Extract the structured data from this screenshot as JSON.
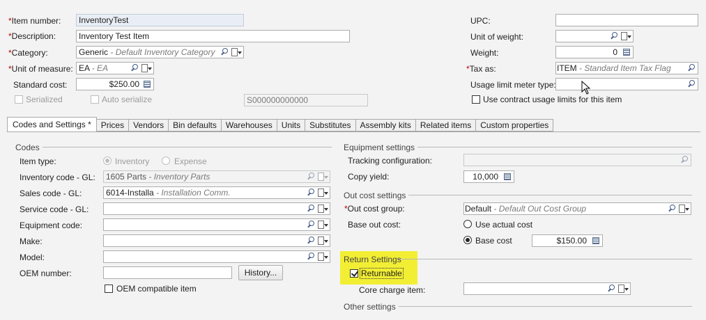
{
  "header": {
    "item_number": {
      "label": "Item number:",
      "value": "InventoryTest"
    },
    "description": {
      "label": "Description:",
      "value": "Inventory Test Item"
    },
    "category": {
      "label": "Category:",
      "code": "Generic",
      "desc": "- Default Inventory Category"
    },
    "unit_of_measure": {
      "label": "Unit of measure:",
      "code": "EA",
      "desc": "- EA"
    },
    "standard_cost": {
      "label": "Standard cost:",
      "value": "$250.00"
    },
    "serialized": {
      "label": "Serialized"
    },
    "auto_serialize": {
      "label": "Auto serialize"
    },
    "serial_template": "S000000000000",
    "upc": {
      "label": "UPC:",
      "value": ""
    },
    "unit_of_weight": {
      "label": "Unit of weight:",
      "value": ""
    },
    "weight": {
      "label": "Weight:",
      "value": "0"
    },
    "tax_as": {
      "label": "Tax as:",
      "code": "ITEM",
      "desc": "- Standard Item Tax Flag"
    },
    "usage_limit": {
      "label": "Usage limit meter type:",
      "value": ""
    },
    "contract_usage": {
      "label": "Use contract usage limits for this item"
    }
  },
  "tabs": [
    "Codes and Settings *",
    "Prices",
    "Vendors",
    "Bin defaults",
    "Warehouses",
    "Units",
    "Substitutes",
    "Assembly kits",
    "Related items",
    "Custom properties"
  ],
  "codes": {
    "section": "Codes",
    "item_type": {
      "label": "Item type:",
      "opt1": "Inventory",
      "opt2": "Expense"
    },
    "inventory_gl": {
      "label": "Inventory code - GL:",
      "code": "1605 Parts",
      "desc": "- Inventory Parts"
    },
    "sales_gl": {
      "label": "Sales code - GL:",
      "code": "6014-Installa",
      "desc": "- Installation Comm."
    },
    "service_gl": {
      "label": "Service code - GL:",
      "value": ""
    },
    "equipment": {
      "label": "Equipment code:",
      "value": ""
    },
    "make": {
      "label": "Make:",
      "value": ""
    },
    "model": {
      "label": "Model:",
      "value": ""
    },
    "oem": {
      "label": "OEM number:",
      "value": ""
    },
    "history_button": "History...",
    "oem_compatible": "OEM compatible item"
  },
  "equipment": {
    "section": "Equipment settings",
    "tracking": {
      "label": "Tracking configuration:",
      "value": ""
    },
    "copy_yield": {
      "label": "Copy yield:",
      "value": "10,000"
    }
  },
  "out_cost": {
    "section": "Out cost settings",
    "group": {
      "label": "Out cost group:",
      "code": "Default",
      "desc": "- Default Out Cost Group"
    },
    "base_label": "Base out cost:",
    "use_actual": "Use actual cost",
    "base_cost": "Base cost",
    "base_cost_value": "$150.00"
  },
  "return": {
    "section": "Return Settings",
    "returnable": "Returnable",
    "core_charge": {
      "label": "Core charge item:",
      "value": ""
    }
  },
  "other": {
    "section": "Other settings"
  },
  "colors": {
    "highlight": "#f2ee34",
    "required": "#c00000"
  }
}
